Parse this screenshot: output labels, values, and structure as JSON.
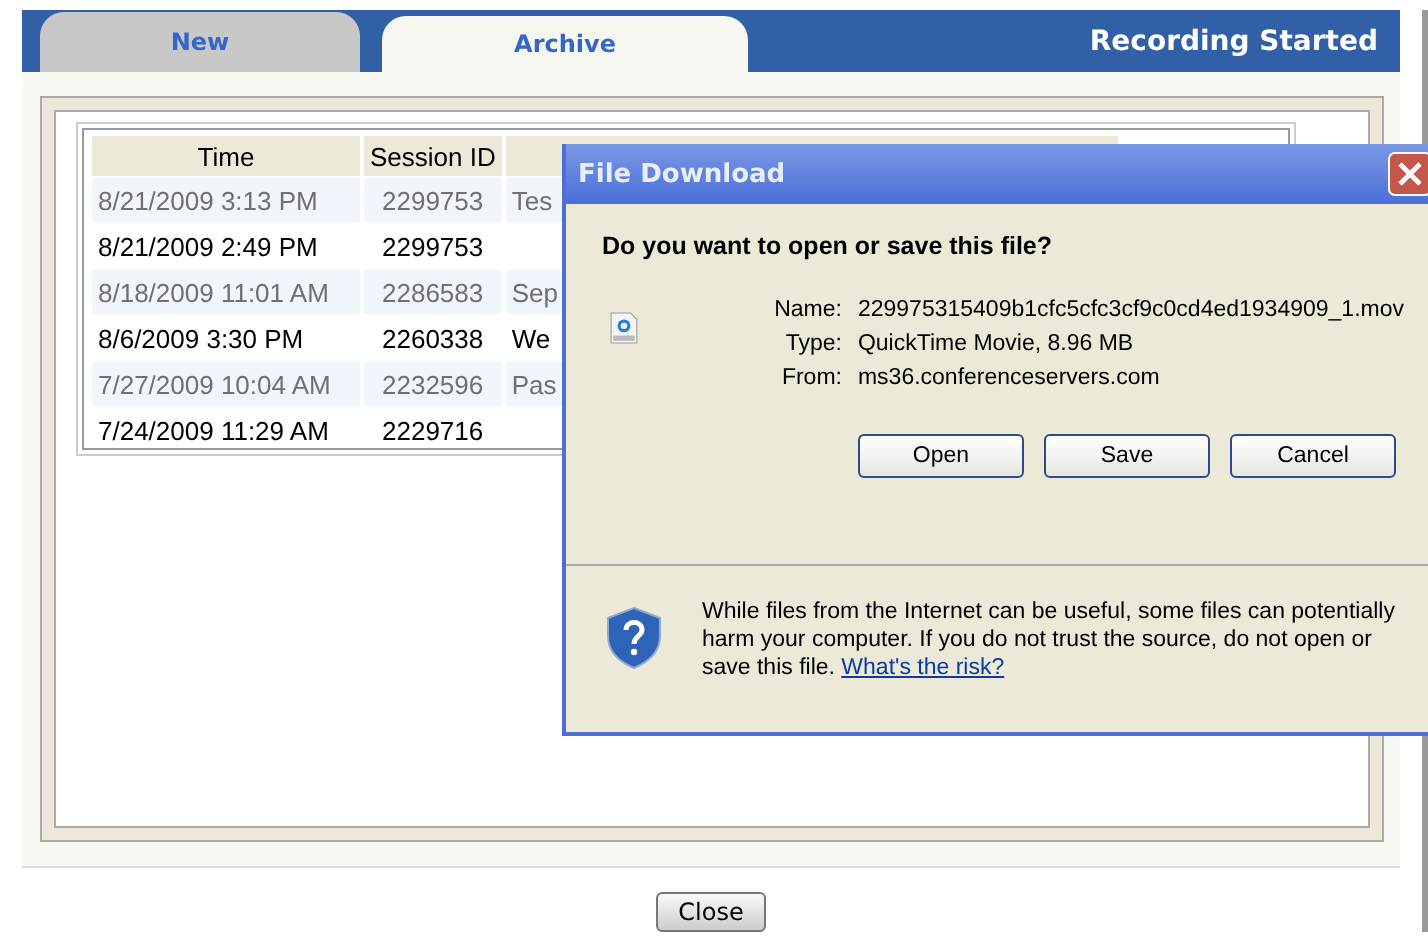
{
  "tabs": [
    {
      "label": "New",
      "selected": false
    },
    {
      "label": "Archive",
      "selected": true
    }
  ],
  "status": "Recording Started",
  "table": {
    "columns": [
      "Time",
      "Session ID"
    ],
    "rows": [
      {
        "cells": [
          "8/21/2009 3:13 PM",
          "2299753",
          "Tes"
        ]
      },
      {
        "cells": [
          "8/21/2009 2:49 PM",
          "2299753",
          ""
        ]
      },
      {
        "cells": [
          "8/18/2009 11:01 AM",
          "2286583",
          "Sep"
        ]
      },
      {
        "cells": [
          "8/6/2009 3:30 PM",
          "2260338",
          "We"
        ]
      },
      {
        "cells": [
          "7/27/2009 10:04 AM",
          "2232596",
          "Pas"
        ]
      },
      {
        "cells": [
          "7/24/2009 11:29 AM",
          "2229716",
          ""
        ]
      }
    ]
  },
  "dialog": {
    "title": "File Download",
    "question": "Do you want to open or save this file?",
    "fields": [
      {
        "label": "Name:",
        "value": "229975315409b1cfc5cfc3cf9c0cd4ed1934909_1.mov"
      },
      {
        "label": "Type:",
        "value": "QuickTime Movie, 8.96 MB"
      },
      {
        "label": "From:",
        "value": "ms36.conferenceservers.com"
      }
    ],
    "buttons": [
      "Open",
      "Save",
      "Cancel"
    ],
    "warning": "While files from the Internet can be useful, some files can potentially harm your computer. If you do not trust the source, do not open or save this file.",
    "risk_link": "What's the risk?"
  },
  "close_button": "Close"
}
